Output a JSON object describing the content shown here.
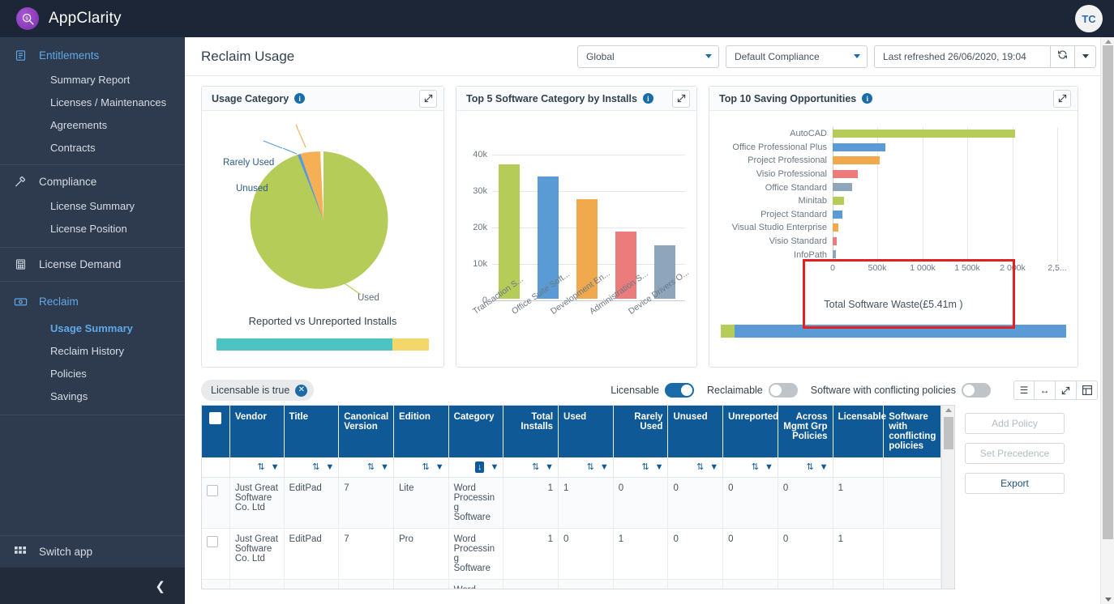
{
  "app": {
    "brand": "AppClarity",
    "logo_icon": "magnifier-dollar-icon",
    "avatar_initials": "TC"
  },
  "sidebar": {
    "groups": [
      {
        "top": {
          "label": "Entitlements",
          "icon": "clipboard-icon",
          "active": true
        },
        "items": [
          {
            "label": "Summary Report"
          },
          {
            "label": "Licenses / Maintenances"
          },
          {
            "label": "Agreements"
          },
          {
            "label": "Contracts"
          }
        ]
      },
      {
        "top": {
          "label": "Compliance",
          "icon": "gavel-icon",
          "active": false
        },
        "items": [
          {
            "label": "License Summary"
          },
          {
            "label": "License Position"
          }
        ]
      },
      {
        "top": {
          "label": "License Demand",
          "icon": "calculator-icon",
          "active": false
        },
        "items": []
      },
      {
        "top": {
          "label": "Reclaim",
          "icon": "banknote-icon",
          "active": true
        },
        "items": [
          {
            "label": "Usage Summary",
            "active": true
          },
          {
            "label": "Reclaim History"
          },
          {
            "label": "Policies"
          },
          {
            "label": "Savings"
          }
        ]
      }
    ],
    "switch_app": {
      "label": "Switch app",
      "icon": "grid-apps-icon"
    },
    "collapse_icon": "chevron-left-icon"
  },
  "header": {
    "title": "Reclaim Usage",
    "scope_select": "Global",
    "compliance_select": "Default Compliance",
    "refreshed": "Last refreshed 26/06/2020, 19:04",
    "refresh_icon": "refresh-icon",
    "refresh_caret_icon": "chevron-down-icon"
  },
  "cards": {
    "usage_category": {
      "title": "Usage Category",
      "info_icon": "info-icon",
      "expand_icon": "expand-arrows-icon",
      "caption": "Reported vs Unreported Installs"
    },
    "top5": {
      "title": "Top 5 Software Category by Installs",
      "info_icon": "info-icon",
      "expand_icon": "expand-arrows-icon"
    },
    "top10": {
      "title": "Top 10 Saving Opportunities",
      "info_icon": "info-icon",
      "expand_icon": "expand-arrows-icon",
      "waste_caption": "Total Software Waste(£5.41m )"
    }
  },
  "chart_data": [
    {
      "type": "pie",
      "title": "Usage Category",
      "labels": [
        "Used",
        "Rarely Used",
        "Unused"
      ],
      "values": [
        90.5,
        8.2,
        1.3
      ],
      "colors": [
        "#b5cc59",
        "#f5b055",
        "#5b9bd5"
      ],
      "annotations": [
        "Rarely Used",
        "Unused",
        "Used"
      ],
      "legend": "callout-labels",
      "secondary": {
        "type": "stacked-bar",
        "title": "Reported vs Unreported Installs",
        "segments": [
          {
            "name": "Reported",
            "value": 83,
            "color": "#4ec3c3"
          },
          {
            "name": "Unreported",
            "value": 17,
            "color": "#f4d76a"
          }
        ]
      }
    },
    {
      "type": "bar",
      "title": "Top 5 Software Category by Installs",
      "categories": [
        "Transaction S...",
        "Office Suite Soft...",
        "Development En...",
        "Administration S...",
        "Device Drivers O..."
      ],
      "values": [
        36800,
        33600,
        27400,
        18500,
        14600
      ],
      "colors": [
        "#b5cc59",
        "#5b9bd5",
        "#f0a94c",
        "#ec7b7b",
        "#8fa5bb"
      ],
      "ylabel": "",
      "xlabel": "",
      "ylim": [
        0,
        40000
      ],
      "ytick_labels": [
        "0",
        "10k",
        "20k",
        "30k",
        "40k"
      ],
      "ytick_values": [
        0,
        10000,
        20000,
        30000,
        40000
      ],
      "grid": true
    },
    {
      "type": "bar",
      "orientation": "horizontal",
      "title": "Top 10 Saving Opportunities",
      "categories": [
        "AutoCAD",
        "Office Professional Plus",
        "Project Professional",
        "Visio Professional",
        "Office Standard",
        "Minitab",
        "Project Standard",
        "Visual Studio Enterprise",
        "Visio Standard",
        "InfoPath"
      ],
      "values": [
        2030000,
        590000,
        525000,
        280000,
        215000,
        120000,
        110000,
        55000,
        40000,
        32000
      ],
      "colors": [
        "#b5cc59",
        "#5b9bd5",
        "#f0a94c",
        "#ec7b7b",
        "#8fa5bb",
        "#b5cc59",
        "#5b9bd5",
        "#f0a94c",
        "#ec7b7b",
        "#8fa5bb"
      ],
      "xtick_labels": [
        "0",
        "500k",
        "1 000k",
        "1 500k",
        "2 000k",
        "2,5..."
      ],
      "xtick_values": [
        0,
        500000,
        1000000,
        1500000,
        2000000,
        2500000
      ],
      "xlim": [
        0,
        2600000
      ],
      "grid": true,
      "secondary": {
        "type": "stacked-bar",
        "title": "Total Software Waste(£5.41m )",
        "segments": [
          {
            "name": "green",
            "value": 4,
            "color": "#b5cc59"
          },
          {
            "name": "blue",
            "value": 96,
            "color": "#5b9bd5"
          }
        ]
      }
    }
  ],
  "filters": {
    "chip": {
      "label": "Licensable is true",
      "remove_icon": "close-circle-icon"
    },
    "toggles": [
      {
        "label": "Licensable",
        "on": true
      },
      {
        "label": "Reclaimable",
        "on": false
      },
      {
        "label": "Software with conflicting policies",
        "on": false
      }
    ],
    "view_icons": [
      "list-view-icon",
      "fit-width-icon",
      "expand-arrows-icon",
      "grid-view-icon"
    ]
  },
  "table": {
    "columns": [
      {
        "label": "",
        "name": "select-all",
        "align": "left"
      },
      {
        "label": "Vendor",
        "align": "left",
        "sortable": true
      },
      {
        "label": "Title",
        "align": "left",
        "sortable": true
      },
      {
        "label": "Canonical Version",
        "align": "left",
        "sortable": true
      },
      {
        "label": "Edition",
        "align": "left",
        "sortable": true
      },
      {
        "label": "Category",
        "align": "left",
        "sortable": true,
        "sorted": "asc"
      },
      {
        "label": "Total Installs",
        "align": "right",
        "sortable": true
      },
      {
        "label": "Used",
        "align": "left",
        "sortable": true
      },
      {
        "label": "Rarely Used",
        "align": "right",
        "sortable": true
      },
      {
        "label": "Unused",
        "align": "left",
        "sortable": true
      },
      {
        "label": "Unreported",
        "align": "right",
        "sortable": true
      },
      {
        "label": "Across Mgmt Grp Policies",
        "align": "right",
        "sortable": true
      },
      {
        "label": "Licensable",
        "align": "left",
        "sortable": false
      },
      {
        "label": "Software with conflicting policies",
        "align": "left",
        "sortable": false
      }
    ],
    "rows": [
      {
        "vendor": "Just Great Software Co. Ltd",
        "title": "EditPad",
        "canonical_version": "7",
        "edition": "Lite",
        "category": "Word Processing Software",
        "total_installs": "1",
        "used": "1",
        "rarely_used": "0",
        "unused": "0",
        "unreported": "0",
        "across_mgmt_grp_policies": "0",
        "licensable": "1",
        "conflicting": ""
      },
      {
        "vendor": "Just Great Software Co. Ltd",
        "title": "EditPad",
        "canonical_version": "7",
        "edition": "Pro",
        "category": "Word Processing Software",
        "total_installs": "1",
        "used": "0",
        "rarely_used": "1",
        "unused": "0",
        "unreported": "0",
        "across_mgmt_grp_policies": "0",
        "licensable": "1",
        "conflicting": ""
      },
      {
        "vendor": "",
        "title": "",
        "canonical_version": "",
        "edition": "",
        "category": "Word",
        "total_installs": "",
        "used": "",
        "rarely_used": "",
        "unused": "",
        "unreported": "",
        "across_mgmt_grp_policies": "",
        "licensable": "",
        "conflicting": ""
      }
    ],
    "sort_icon": "sort-icon",
    "filter_icon": "funnel-icon"
  },
  "actions": {
    "add_policy": "Add Policy",
    "set_precedence": "Set Precedence",
    "export": "Export"
  }
}
